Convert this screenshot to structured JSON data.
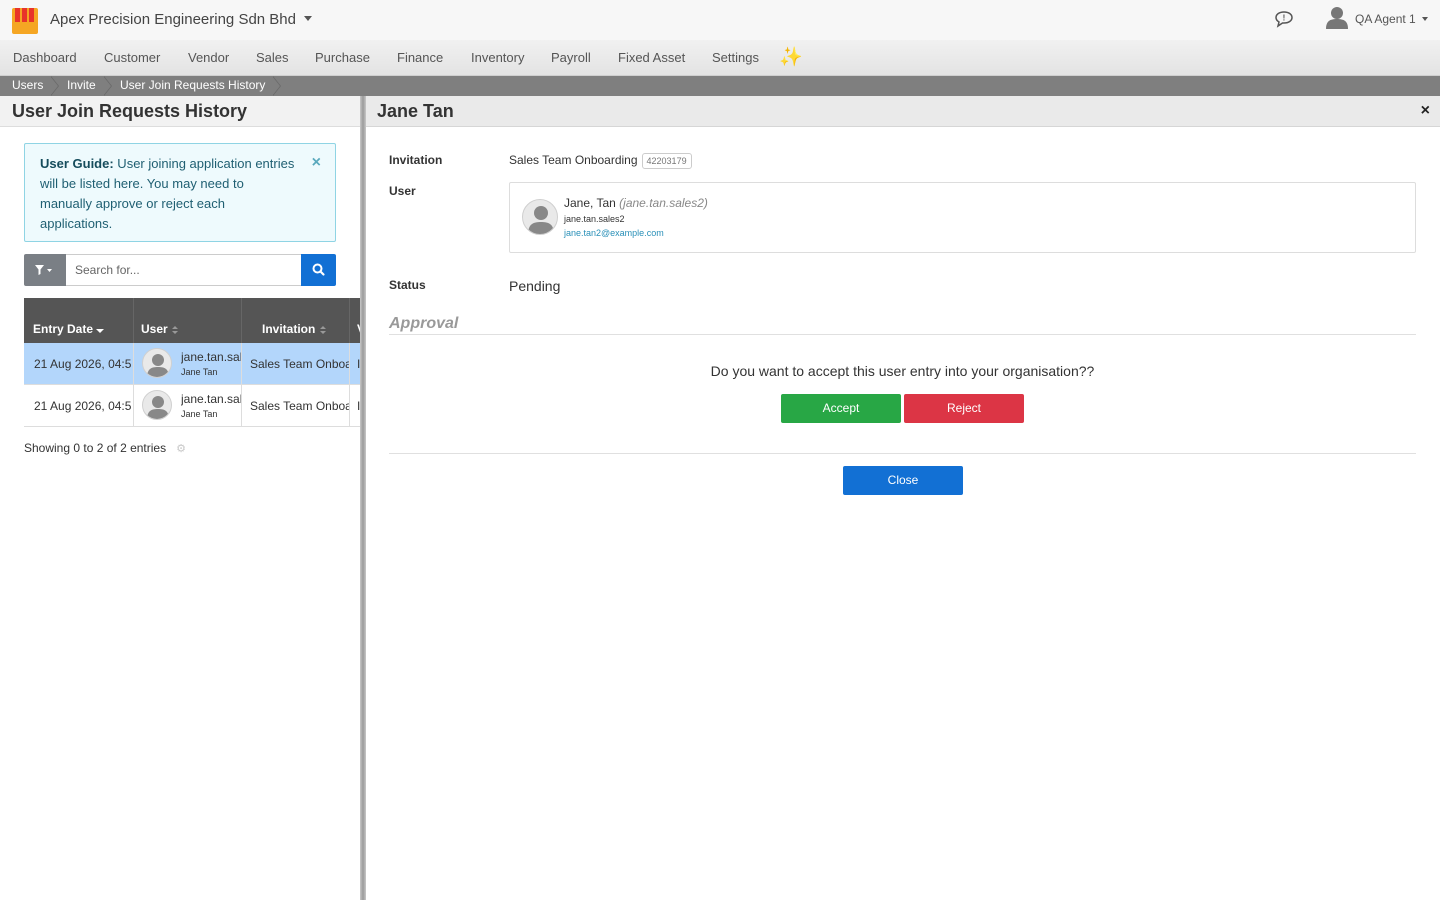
{
  "app": {
    "company": "Apex Precision Engineering Sdn Bhd",
    "user_name": "QA Agent 1"
  },
  "nav": {
    "items": [
      "Dashboard",
      "Customer",
      "Vendor",
      "Sales",
      "Purchase",
      "Finance",
      "Inventory",
      "Payroll",
      "Fixed Asset",
      "Settings"
    ],
    "sparkle": "✨"
  },
  "breadcrumb": [
    "Users",
    "Invite",
    "User Join Requests History"
  ],
  "left": {
    "title": "User Join Requests History",
    "guide_label": "User Guide:",
    "guide_text": " User joining application entries will be listed here. You may need to manually approve or reject each applications.",
    "guide_close": "×",
    "search_placeholder": "Search for...",
    "columns": [
      "Entry Date",
      "User",
      "Invitation",
      "V"
    ],
    "rows": [
      {
        "date": "21 Aug 2026, 04:5",
        "user_login": "jane.tan.sal",
        "user_name": "Jane Tan",
        "invitation": "Sales Team Onboa",
        "extra": "I"
      },
      {
        "date": "21 Aug 2026, 04:5",
        "user_login": "jane.tan.sal",
        "user_name": "Jane Tan",
        "invitation": "Sales Team Onboa",
        "extra": "I"
      }
    ],
    "entries": "Showing 0 to 2 of 2 entries",
    "gear": "⚙"
  },
  "detail": {
    "title": "Jane Tan",
    "close": "×",
    "invitation_label": "Invitation",
    "invitation_value": "Sales Team Onboarding",
    "invitation_code": "42203179",
    "user_label": "User",
    "user_display": "Jane, Tan",
    "user_alias": "(jane.tan.sales2)",
    "user_login": "jane.tan.sales2",
    "user_email": "jane.tan2@example.com",
    "status_label": "Status",
    "status_value": "Pending",
    "approval_heading": "Approval",
    "question": "Do you want to accept this user entry into your organisation??",
    "accept_label": "Accept",
    "reject_label": "Reject",
    "close_label": "Close"
  }
}
